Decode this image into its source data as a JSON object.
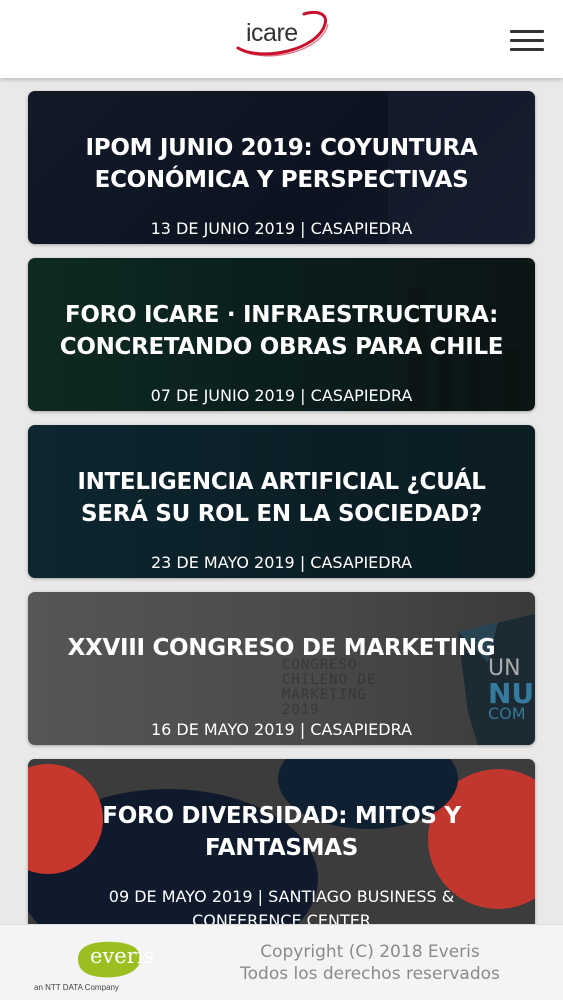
{
  "header": {
    "logo_text": "icare",
    "menu_icon": "hamburger-menu-icon",
    "logo_accent_color": "#c8102e"
  },
  "events": [
    {
      "title_line1": "IPOM JUNIO 2019: COYUNTURA",
      "title_line2": "ECONÓMICA Y PERSPECTIVAS",
      "meta": "13 DE JUNIO 2019 | CASAPIEDRA"
    },
    {
      "title_line1": "FORO ICARE · INFRAESTRUCTURA:",
      "title_line2": "CONCRETANDO OBRAS PARA CHILE",
      "meta": "07 DE JUNIO 2019 | CASAPIEDRA"
    },
    {
      "title_line1": "INTELIGENCIA ARTIFICIAL ¿CUÁL",
      "title_line2": "SERÁ SU ROL EN LA SOCIEDAD?",
      "meta": "23 DE MAYO 2019 | CASAPIEDRA"
    },
    {
      "title_line1": "XXVIII CONGRESO DE MARKETING",
      "meta": "16 DE MAYO 2019 | CASAPIEDRA",
      "background_text": "CONGRESO\nCHILENO DE\nMARKETING\n2019",
      "background_side_text_1": "UN",
      "background_side_text_2": "NU",
      "background_side_text_3": "COM"
    },
    {
      "title_line1": "FORO DIVERSIDAD: MITOS Y",
      "title_line2": "FANTASMAS",
      "meta_line1": "09 DE MAYO 2019 | SANTIAGO BUSINESS &",
      "meta_line2": "CONFERENCE CENTER"
    }
  ],
  "footer": {
    "brand": "everis",
    "brand_sub": "an NTT DATA Company",
    "copyright_line1": "Copyright (C) 2018 Everis",
    "copyright_line2": "Todos los derechos reservados",
    "brand_color": "#9bbf20"
  }
}
